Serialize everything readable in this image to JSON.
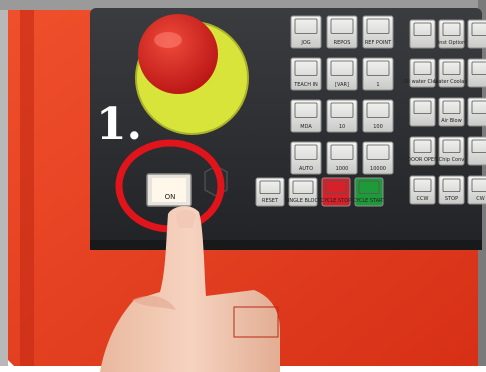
{
  "annotation": {
    "step_label": "1.",
    "circle_color": "#e0141b"
  },
  "colors": {
    "cabinet": "#e23a1e",
    "panel": "#2b2d30",
    "estop": "#d61d1d",
    "estop_ring": "#d8e43a",
    "skin": "#f0c7b0"
  },
  "panel": {
    "mode_keys": [
      {
        "label": "JOG",
        "icon": "jog-icon"
      },
      {
        "label": "REPOS",
        "icon": "repos-icon"
      },
      {
        "label": "REF POINT",
        "icon": "ref-point-icon"
      },
      {
        "label": "TEACH IN",
        "icon": "teach-in-icon"
      },
      {
        "label": "[VAR]",
        "icon": "var-icon"
      },
      {
        "label": "1",
        "icon": "increment-icon"
      },
      {
        "label": "MDA",
        "icon": "mda-icon"
      },
      {
        "label": "10",
        "icon": "increment-icon"
      },
      {
        "label": "100",
        "icon": "increment-icon"
      },
      {
        "label": "AUTO",
        "icon": "auto-icon"
      },
      {
        "label": "1000",
        "icon": "increment-icon"
      },
      {
        "label": "10000",
        "icon": "increment-icon"
      }
    ],
    "bottom_keys": [
      {
        "label": "RESET",
        "icon": "reset-icon"
      },
      {
        "label": "SINGLE BLOCK",
        "icon": "single-block-icon"
      },
      {
        "label": "CYCLE STOP",
        "icon": "cycle-stop-icon",
        "color": "#d6202a"
      },
      {
        "label": "CYCLE START",
        "icon": "cycle-start-icon",
        "color": "#1e9a3a"
      }
    ],
    "right_keys": [
      {
        "label": "",
        "icon": "blank-key-icon"
      },
      {
        "label": "Inst Option",
        "icon": "inst-option-icon"
      },
      {
        "label": "",
        "icon": "blank-key-icon"
      },
      {
        "label": "Oil water Clean",
        "icon": "oil-water-icon"
      },
      {
        "label": "Water Coolant",
        "icon": "water-coolant-icon"
      },
      {
        "label": "",
        "icon": "blank-key-icon"
      },
      {
        "label": "",
        "icon": "blank-key-icon"
      },
      {
        "label": "Air Blow",
        "icon": "air-blow-icon"
      },
      {
        "label": "",
        "icon": "blank-key-icon"
      },
      {
        "label": "DOOR OPEN",
        "icon": "door-open-icon"
      },
      {
        "label": "Chip Conv",
        "icon": "chip-conveyor-icon"
      },
      {
        "label": "",
        "icon": "alarm-icon"
      },
      {
        "label": "CCW",
        "icon": "spindle-ccw-icon"
      },
      {
        "label": "STOP",
        "icon": "spindle-stop-icon"
      },
      {
        "label": "CW",
        "icon": "spindle-cw-icon"
      }
    ],
    "power_button_label": "ON"
  }
}
